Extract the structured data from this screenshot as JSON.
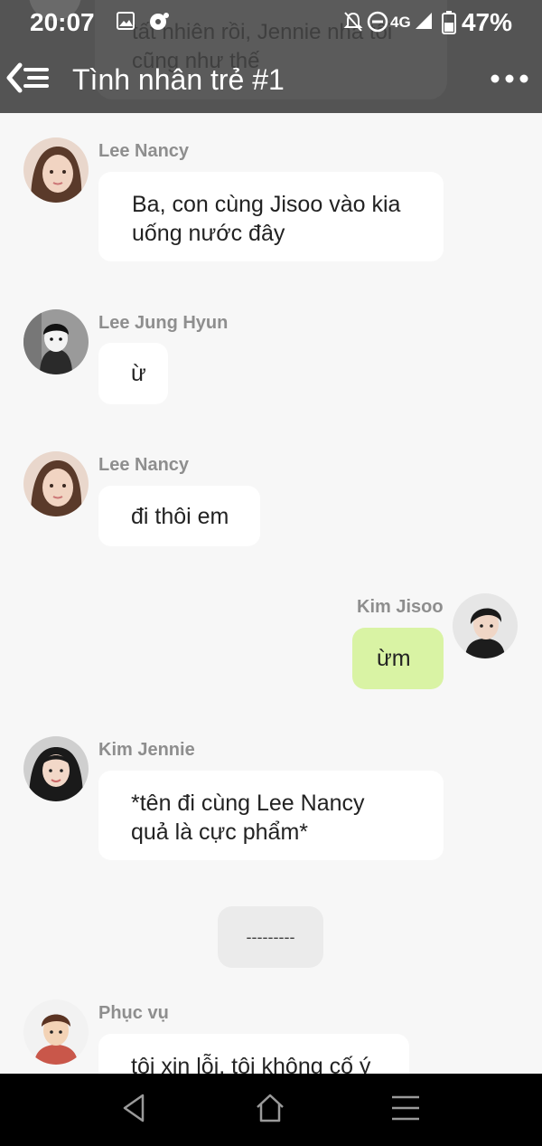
{
  "status_bar": {
    "time": "20:07",
    "network": "4G",
    "battery": "47%"
  },
  "header": {
    "title": "Tình nhân trẻ #1",
    "ghost_message": "tất nhiên rồi, Jennie nhà tôi\ncũng như thế"
  },
  "messages": [
    {
      "sender": "Lee Nancy",
      "text": "Ba, con cùng Jisoo vào kia\nuống nước đây",
      "side": "left"
    },
    {
      "sender": "Lee Jung Hyun",
      "text": "ừ",
      "side": "left"
    },
    {
      "sender": "Lee Nancy",
      "text": "đi thôi em",
      "side": "left"
    },
    {
      "sender": "Kim Jisoo",
      "text": "ừm",
      "side": "right"
    },
    {
      "sender": "Kim Jennie",
      "text": "*tên đi cùng Lee Nancy\nquả là cực phẩm*",
      "side": "left"
    },
    {
      "sender": "Phục vụ",
      "text": "tôi xin lỗi, tôi không cố ý",
      "side": "left"
    }
  ],
  "system_message": "---------",
  "colors": {
    "header_bg": "#545454",
    "chat_bg": "#f7f7f7",
    "bubble_left": "#ffffff",
    "bubble_right": "#d9f3a4",
    "name_color": "#8e8e8e"
  },
  "icons": [
    "back-menu-icon",
    "more-icon",
    "gallery-icon",
    "notification-icon",
    "mute-icon",
    "dnd-icon",
    "signal-icon",
    "battery-icon",
    "nav-back-icon",
    "nav-home-icon",
    "nav-recents-icon"
  ]
}
